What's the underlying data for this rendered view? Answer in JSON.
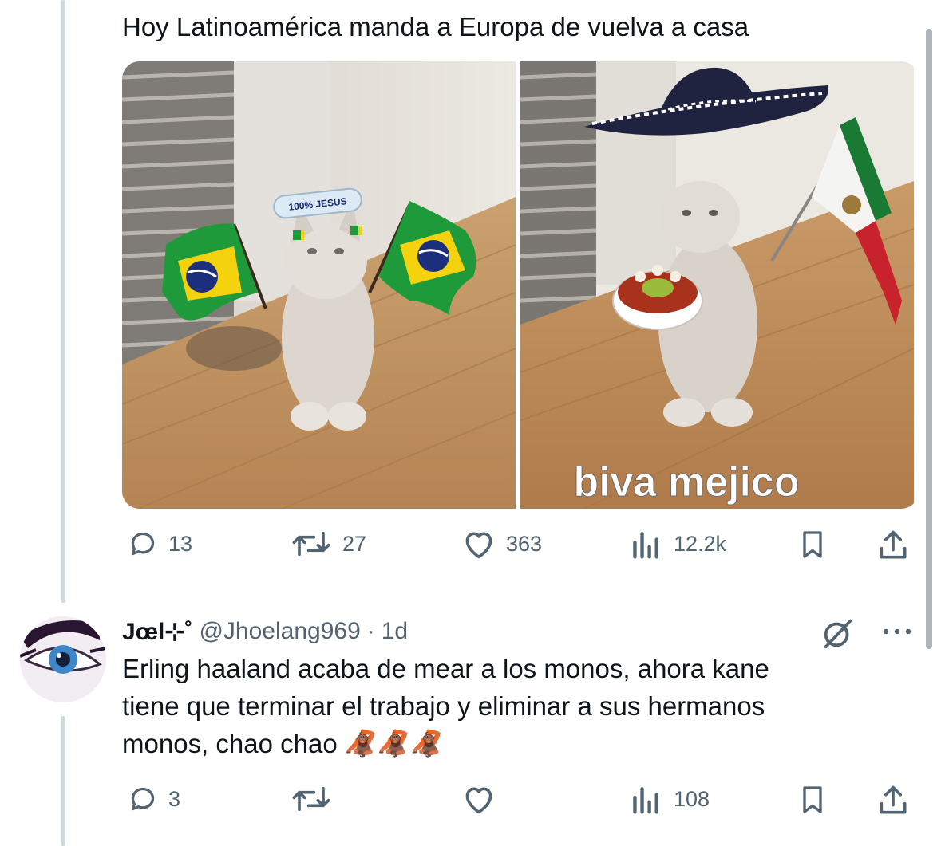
{
  "tweet": {
    "text": "Hoy Latinoamérica manda a Europa de vuelva a casa",
    "media": {
      "left_panel_badge": "100% JESUS",
      "right_panel_caption": "biva mejico"
    },
    "actions": {
      "replies": "13",
      "retweets": "27",
      "likes": "363",
      "views": "12.2k"
    }
  },
  "reply": {
    "display_name": "Jœl⊹˚",
    "handle": "@Jhoelang969",
    "separator": "·",
    "time": "1d",
    "text_lines": [
      "Erling haaland acaba de mear a los monos, ahora kane",
      "tiene que terminar el trabajo y eliminar a sus hermanos",
      "monos, chao chao "
    ],
    "emoji": "🦧🦧🦧",
    "actions": {
      "replies": "3",
      "retweets": "",
      "likes": "",
      "views": "108"
    }
  },
  "colors": {
    "text": "#0f1419",
    "secondary": "#536471",
    "thread_line": "#cfd9de",
    "flag_green": "#1f9a3a",
    "flag_yellow": "#f5d20e",
    "flag_blue": "#1c2f7c",
    "mexico_red": "#c8232c"
  },
  "icons": [
    "reply-icon",
    "retweet-icon",
    "like-icon",
    "views-icon",
    "bookmark-icon",
    "share-icon",
    "more-icon",
    "grok-icon"
  ]
}
